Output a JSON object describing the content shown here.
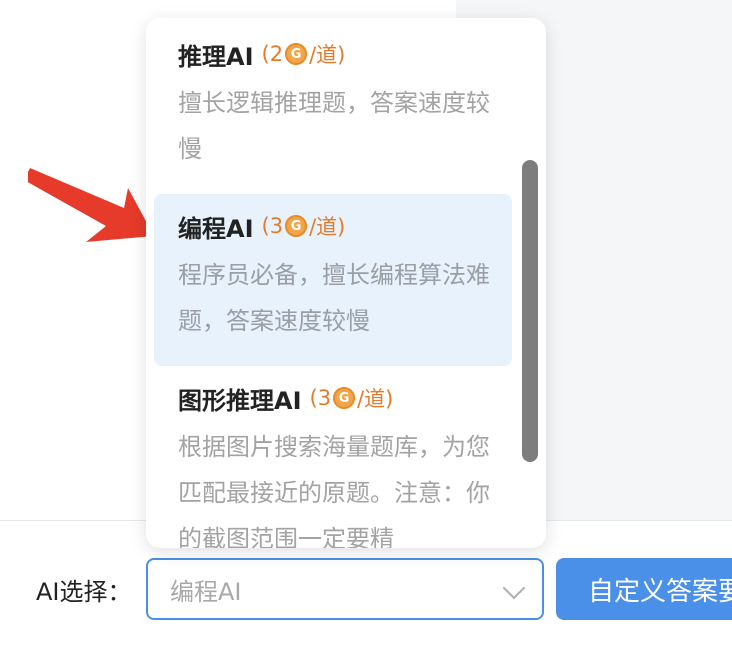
{
  "options": [
    {
      "name": "推理AI",
      "cost_open": "(2",
      "cost_close": "/道)",
      "description": "擅长逻辑推理题，答案速度较慢"
    },
    {
      "name": "编程AI",
      "cost_open": "(3",
      "cost_close": "/道)",
      "description": "程序员必备，擅长编程算法难题，答案速度较慢",
      "selected": true
    },
    {
      "name": "图形推理AI",
      "cost_open": "(3",
      "cost_close": "/道)",
      "description": "根据图片搜索海量题库，为您匹配最接近的原题。注意：你的截图范围一定要精"
    }
  ],
  "coin_glyph": "G",
  "ai_select": {
    "label": "AI选择：",
    "value": "编程AI"
  },
  "action_button": {
    "label": "自定义答案要求"
  },
  "colors": {
    "accent": "#4a90e8",
    "selected_bg": "#e8f2fd",
    "cost": "#e07c2c",
    "arrow": "#e63a2a"
  },
  "icons": {
    "arrow": "red-pointer-arrow-icon",
    "coin": "coin-icon",
    "chevron": "chevron-down-icon"
  }
}
